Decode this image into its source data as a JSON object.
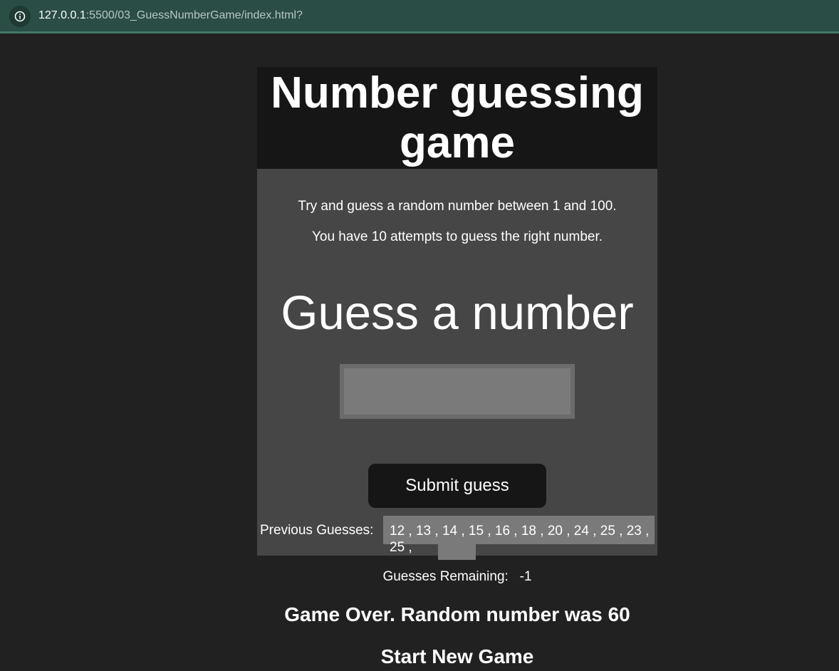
{
  "browser": {
    "url_host": "127.0.0.1",
    "url_path": ":5500/03_GuessNumberGame/index.html?"
  },
  "game": {
    "title": "Number guessing game",
    "instructions_1": "Try and guess a random number between 1 and 100.",
    "instructions_2": "You have 10 attempts to guess the right number.",
    "guess_heading": "Guess a number",
    "input_value": "",
    "submit_label": "Submit guess",
    "previous_guesses_label": "Previous Guesses:",
    "previous_guesses": "12 , 13 , 14 , 15 , 16 , 18 , 20 , 24 , 25 , 23 , 25 ,",
    "remaining_label": "Guesses Remaining:",
    "remaining_value": "-1",
    "game_over_message": "Game Over. Random number was 60",
    "new_game_label": "Start New Game"
  },
  "colors": {
    "page_background": "#212121",
    "card_background": "#464646",
    "title_background": "#161616",
    "browser_bar": "#2a4d45",
    "input_background": "#7a7a7a"
  }
}
